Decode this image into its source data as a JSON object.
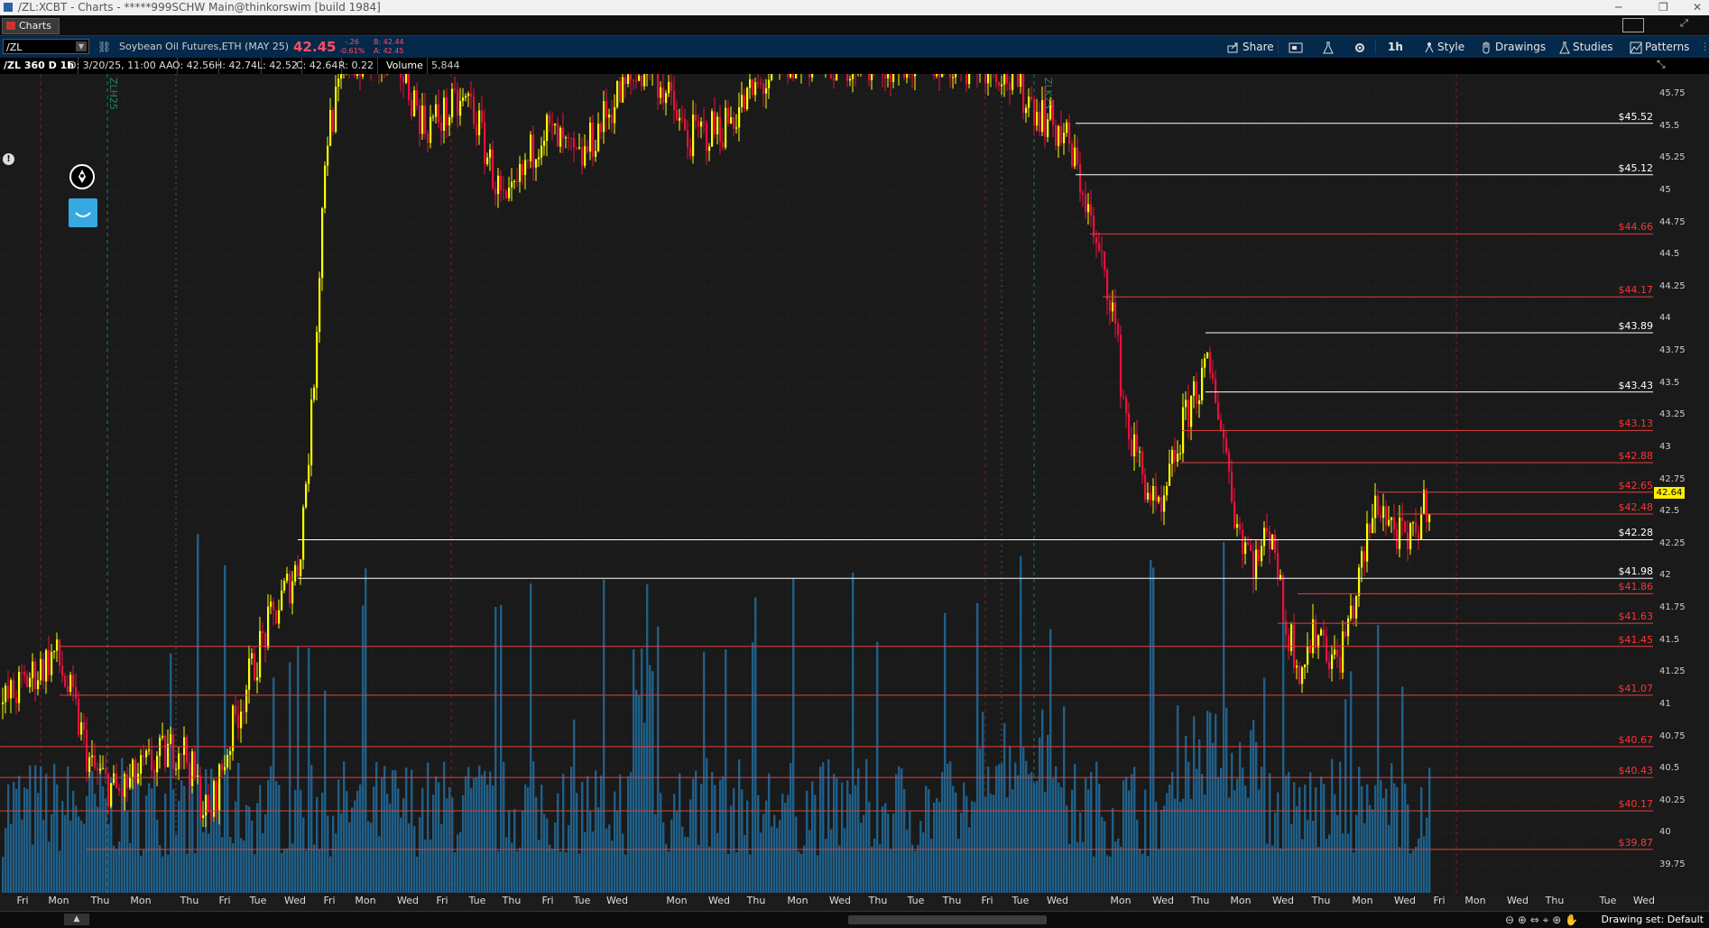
{
  "window": {
    "title": "/ZL:XCBT - Charts - *****999SCHW Main@thinkorswim [build 1984]"
  },
  "tab": {
    "label": "Charts"
  },
  "toolbar": {
    "symbol": "/ZL",
    "description": "Soybean Oil Futures,ETH (MAY 25)",
    "last": "42.45",
    "change": "-.26",
    "change_pct": "-0.61%",
    "bid": "B: 42.44",
    "ask": "A: 42.45",
    "share": "Share",
    "timeframe": "1h",
    "style": "Style",
    "drawings": "Drawings",
    "studies": "Studies",
    "patterns": "Patterns"
  },
  "infobar": {
    "symbol_period": "/ZL 360 D 1h",
    "date": "D: 3/20/25, 11:00 AA",
    "open": "O: 42.56",
    "high": "H: 42.74",
    "low": "L: 42.52",
    "close": "C: 42.64",
    "range": "R: 0.22",
    "volume_label": "Volume",
    "volume_value": "5,844"
  },
  "chart": {
    "current_price": "42.64",
    "period_markers": [
      "ZLH25",
      "ZLK25"
    ],
    "y_ticks": [
      "45.75",
      "45.5",
      "45.25",
      "45",
      "44.75",
      "44.5",
      "44.25",
      "44",
      "43.75",
      "43.5",
      "43.25",
      "43",
      "42.75",
      "42.5",
      "42.25",
      "42",
      "41.75",
      "41.5",
      "41.25",
      "41",
      "40.75",
      "40.5",
      "40.25",
      "40",
      "39.75"
    ],
    "level_labels": [
      {
        "text": "$45.52",
        "color": "white"
      },
      {
        "text": "$45.12",
        "color": "white"
      },
      {
        "text": "$44.66",
        "color": "red"
      },
      {
        "text": "$44.17",
        "color": "red"
      },
      {
        "text": "$43.89",
        "color": "white"
      },
      {
        "text": "$43.43",
        "color": "white"
      },
      {
        "text": "$43.13",
        "color": "red"
      },
      {
        "text": "$42.88",
        "color": "red"
      },
      {
        "text": "$42.65",
        "color": "red"
      },
      {
        "text": "$42.48",
        "color": "red"
      },
      {
        "text": "$42.28",
        "color": "white"
      },
      {
        "text": "$41.98",
        "color": "white"
      },
      {
        "text": "$41.86",
        "color": "red"
      },
      {
        "text": "$41.63",
        "color": "red"
      },
      {
        "text": "$41.45",
        "color": "red"
      },
      {
        "text": "$41.07",
        "color": "red"
      },
      {
        "text": "$40.67",
        "color": "red"
      },
      {
        "text": "$40.43",
        "color": "red"
      },
      {
        "text": "$40.17",
        "color": "red"
      },
      {
        "text": "$39.87",
        "color": "red"
      }
    ],
    "x_ticks": [
      "Fri",
      "Mon",
      "Thu",
      "Mon",
      "Thu",
      "Fri",
      "Tue",
      "Wed",
      "Fri",
      "Mon",
      "Wed",
      "Fri",
      "Tue",
      "Thu",
      "Fri",
      "Tue",
      "Wed",
      "Mon",
      "Wed",
      "Thu",
      "Mon",
      "Wed",
      "Thu",
      "Tue",
      "Thu",
      "Fri",
      "Tue",
      "Wed",
      "Mon",
      "Wed",
      "Thu",
      "Mon",
      "Wed",
      "Thu",
      "Mon",
      "Wed",
      "Fri",
      "Mon",
      "Wed",
      "Thu",
      "Tue",
      "Wed"
    ]
  },
  "colors": {
    "up_candle": "#ffff00",
    "down_candle": "#e8103c",
    "volume": "#1f5f88",
    "level_white": "#ffffff",
    "level_red": "#e0413f"
  },
  "bottombar": {
    "drawing_set": "Drawing set: Default"
  }
}
